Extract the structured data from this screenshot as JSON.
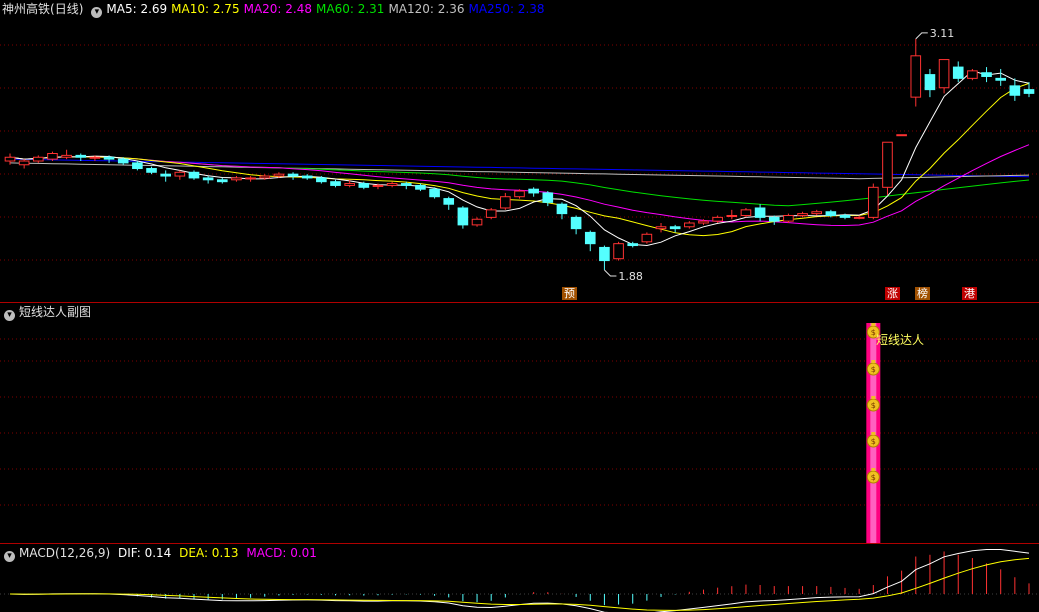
{
  "main_pane": {
    "title": "神州高铁",
    "period": "(日线)",
    "ma": [
      {
        "label": "MA5:",
        "value": "2.69",
        "color": "#ffffff"
      },
      {
        "label": "MA10:",
        "value": "2.75",
        "color": "#ffff00"
      },
      {
        "label": "MA20:",
        "value": "2.48",
        "color": "#ff00ff"
      },
      {
        "label": "MA60:",
        "value": "2.31",
        "color": "#00e000"
      },
      {
        "label": "MA120:",
        "value": "2.36",
        "color": "#c0c0c0"
      },
      {
        "label": "MA250:",
        "value": "2.38",
        "color": "#0000ff"
      }
    ],
    "high_label": "3.11",
    "low_label": "1.88",
    "markers": [
      "预",
      "涨",
      "榜",
      "港"
    ]
  },
  "sub_pane": {
    "title": "短线达人副图",
    "signal_label": "短线达人"
  },
  "macd_pane": {
    "title": "MACD(12,26,9)",
    "dif": "DIF: 0.14",
    "dea": "DEA: 0.13",
    "macd": "MACD: 0.01"
  },
  "colors": {
    "up": "#ff3232",
    "down": "#54ffff",
    "grid": "#800000",
    "separator": "#b00000",
    "signal_bar": "#ff0080"
  },
  "chart_data": {
    "type": "candlestick",
    "price_range": [
      1.8,
      3.2
    ],
    "candles": [
      [
        2.46,
        2.48,
        2.44,
        2.5
      ],
      [
        2.44,
        2.46,
        2.42,
        2.47
      ],
      [
        2.46,
        2.48,
        2.45,
        2.49
      ],
      [
        2.47,
        2.5,
        2.46,
        2.51
      ],
      [
        2.48,
        2.49,
        2.47,
        2.52
      ],
      [
        2.49,
        2.48,
        2.46,
        2.5
      ],
      [
        2.48,
        2.48,
        2.46,
        2.49
      ],
      [
        2.48,
        2.47,
        2.45,
        2.49
      ],
      [
        2.47,
        2.45,
        2.44,
        2.48
      ],
      [
        2.45,
        2.42,
        2.41,
        2.46
      ],
      [
        2.42,
        2.4,
        2.39,
        2.43
      ],
      [
        2.39,
        2.38,
        2.35,
        2.41
      ],
      [
        2.38,
        2.4,
        2.36,
        2.41
      ],
      [
        2.4,
        2.37,
        2.36,
        2.41
      ],
      [
        2.37,
        2.36,
        2.34,
        2.38
      ],
      [
        2.36,
        2.35,
        2.34,
        2.37
      ],
      [
        2.36,
        2.37,
        2.35,
        2.38
      ],
      [
        2.37,
        2.37,
        2.35,
        2.38
      ],
      [
        2.37,
        2.38,
        2.36,
        2.39
      ],
      [
        2.38,
        2.39,
        2.37,
        2.4
      ],
      [
        2.39,
        2.38,
        2.36,
        2.4
      ],
      [
        2.38,
        2.37,
        2.36,
        2.39
      ],
      [
        2.37,
        2.35,
        2.34,
        2.38
      ],
      [
        2.35,
        2.33,
        2.32,
        2.36
      ],
      [
        2.33,
        2.34,
        2.32,
        2.36
      ],
      [
        2.34,
        2.32,
        2.31,
        2.35
      ],
      [
        2.33,
        2.33,
        2.31,
        2.34
      ],
      [
        2.33,
        2.34,
        2.32,
        2.35
      ],
      [
        2.34,
        2.33,
        2.31,
        2.35
      ],
      [
        2.33,
        2.31,
        2.3,
        2.34
      ],
      [
        2.31,
        2.27,
        2.26,
        2.32
      ],
      [
        2.26,
        2.23,
        2.2,
        2.27
      ],
      [
        2.21,
        2.12,
        2.1,
        2.22
      ],
      [
        2.12,
        2.15,
        2.11,
        2.16
      ],
      [
        2.16,
        2.2,
        2.15,
        2.21
      ],
      [
        2.21,
        2.27,
        2.2,
        2.29
      ],
      [
        2.27,
        2.3,
        2.26,
        2.31
      ],
      [
        2.31,
        2.29,
        2.27,
        2.32
      ],
      [
        2.29,
        2.24,
        2.22,
        2.3
      ],
      [
        2.23,
        2.18,
        2.15,
        2.24
      ],
      [
        2.16,
        2.1,
        2.07,
        2.17
      ],
      [
        2.08,
        2.02,
        1.98,
        2.09
      ],
      [
        2.0,
        1.93,
        1.88,
        2.01
      ],
      [
        1.94,
        2.02,
        1.93,
        2.03
      ],
      [
        2.02,
        2.01,
        2.0,
        2.03
      ],
      [
        2.03,
        2.07,
        2.02,
        2.08
      ],
      [
        2.1,
        2.11,
        2.08,
        2.13
      ],
      [
        2.11,
        2.1,
        2.08,
        2.12
      ],
      [
        2.11,
        2.13,
        2.1,
        2.14
      ],
      [
        2.13,
        2.14,
        2.12,
        2.15
      ],
      [
        2.14,
        2.16,
        2.13,
        2.17
      ],
      [
        2.17,
        2.17,
        2.15,
        2.2
      ],
      [
        2.17,
        2.2,
        2.16,
        2.21
      ],
      [
        2.21,
        2.16,
        2.14,
        2.23
      ],
      [
        2.16,
        2.14,
        2.12,
        2.17
      ],
      [
        2.14,
        2.17,
        2.13,
        2.18
      ],
      [
        2.17,
        2.18,
        2.16,
        2.19
      ],
      [
        2.18,
        2.19,
        2.17,
        2.2
      ],
      [
        2.19,
        2.17,
        2.16,
        2.2
      ],
      [
        2.17,
        2.16,
        2.15,
        2.18
      ],
      [
        2.16,
        2.16,
        2.15,
        2.17
      ],
      [
        2.16,
        2.32,
        2.15,
        2.34
      ],
      [
        2.32,
        2.56,
        2.28,
        2.56
      ],
      [
        2.6,
        2.6,
        2.6,
        2.6
      ],
      [
        2.8,
        3.02,
        2.75,
        3.11
      ],
      [
        2.92,
        2.84,
        2.8,
        2.95
      ],
      [
        2.85,
        3.0,
        2.82,
        3.0
      ],
      [
        2.96,
        2.9,
        2.88,
        2.99
      ],
      [
        2.9,
        2.94,
        2.89,
        2.95
      ],
      [
        2.93,
        2.91,
        2.88,
        2.96
      ],
      [
        2.9,
        2.89,
        2.86,
        2.95
      ],
      [
        2.86,
        2.81,
        2.78,
        2.9
      ],
      [
        2.84,
        2.82,
        2.8,
        2.88
      ]
    ]
  }
}
